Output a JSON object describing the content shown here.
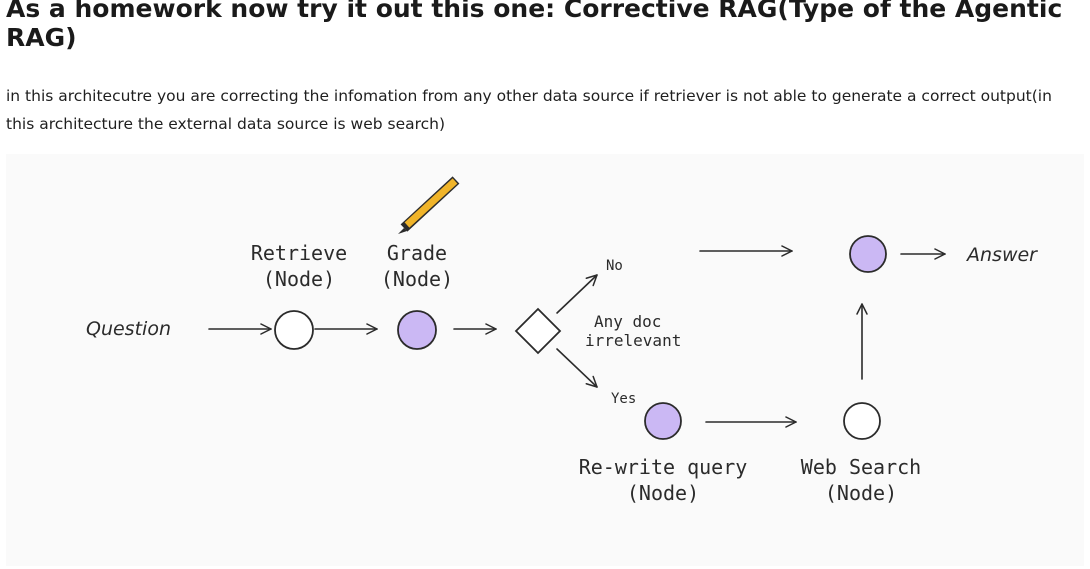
{
  "title": "As a homework now try it out this one: Corrective RAG(Type of the Agentic RAG)",
  "description": "in this architecutre you are correcting the infomation from any other data source if retriever is not able to generate a correct output(in this architecture the external data source is web search)",
  "diagram": {
    "question_label": "Question",
    "retrieve_label": "Retrieve",
    "retrieve_sub": "(Node)",
    "grade_label": "Grade",
    "grade_sub": "(Node)",
    "decision_line1": "Any doc",
    "decision_line2": "irrelevant",
    "no_label": "No",
    "yes_label": "Yes",
    "rewrite_label": "Re-write query",
    "rewrite_sub": "(Node)",
    "websearch_label": "Web Search",
    "websearch_sub": "(Node)",
    "answer_label": "Answer",
    "colors": {
      "filled_node": "#cbb8f4",
      "pencil_body": "#f0b429",
      "background": "#fafafa"
    },
    "icons": [
      "pencil-icon"
    ]
  }
}
